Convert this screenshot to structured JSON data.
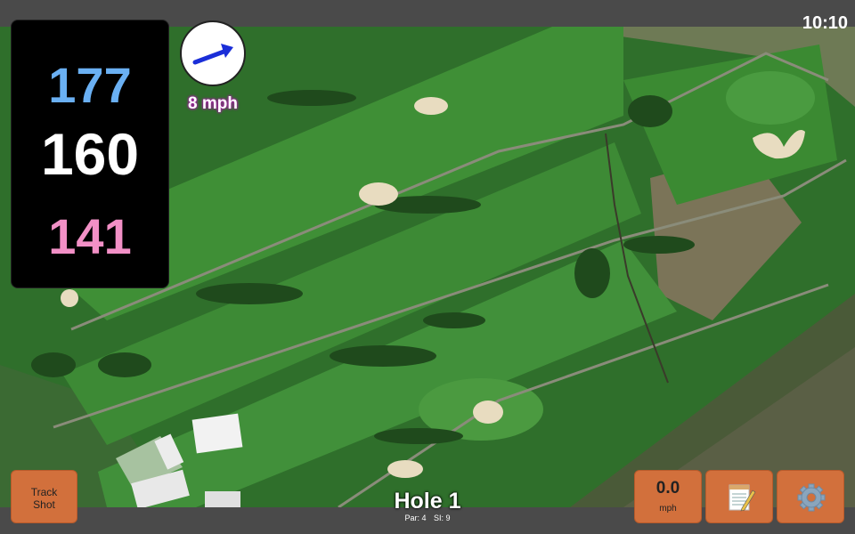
{
  "status": {
    "time": "10:10"
  },
  "distances": {
    "back": "177",
    "middle": "160",
    "front": "141"
  },
  "wind": {
    "speed": "8 mph",
    "icon": "wind-arrow-icon"
  },
  "buttons": {
    "track_shot": [
      "Track",
      "Shot"
    ],
    "wind_value": "0.0",
    "wind_unit": "mph",
    "notes_icon": "notepad-icon",
    "settings_icon": "gear-icon"
  },
  "hole": {
    "title": "Hole 1",
    "par": "Par: 4",
    "si": "SI: 9"
  },
  "colors": {
    "back": "#6ab0f3",
    "front": "#f290c6",
    "button": "#d2703c",
    "wind_glow": "#a020a0"
  }
}
